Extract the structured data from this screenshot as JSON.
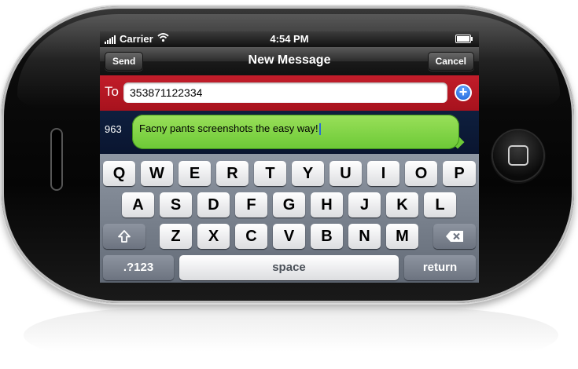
{
  "status_bar": {
    "carrier": "Carrier",
    "time": "4:54 PM",
    "signal_icon": "signal-bars-icon",
    "wifi_icon": "wifi-icon",
    "battery_icon": "battery-icon"
  },
  "nav": {
    "title": "New Message",
    "send_label": "Send",
    "cancel_label": "Cancel"
  },
  "recipient": {
    "label": "To",
    "value": "353871122334",
    "add_icon": "add-contact-icon"
  },
  "compose": {
    "char_count": "963",
    "message": "Facny pants screenshots the easy way!"
  },
  "keyboard": {
    "row1": [
      "Q",
      "W",
      "E",
      "R",
      "T",
      "Y",
      "U",
      "I",
      "O",
      "P"
    ],
    "row2": [
      "A",
      "S",
      "D",
      "F",
      "G",
      "H",
      "J",
      "K",
      "L"
    ],
    "row3": [
      "Z",
      "X",
      "C",
      "V",
      "B",
      "N",
      "M"
    ],
    "shift_icon": "shift-icon",
    "backspace_icon": "backspace-icon",
    "numbers_label": ".?123",
    "space_label": "space",
    "return_label": "return"
  },
  "colors": {
    "to_bar": "#b0151f",
    "bubble": "#7bd243",
    "compose_bg": "#0d1c3a",
    "keyboard_bg": "#7c8490"
  }
}
